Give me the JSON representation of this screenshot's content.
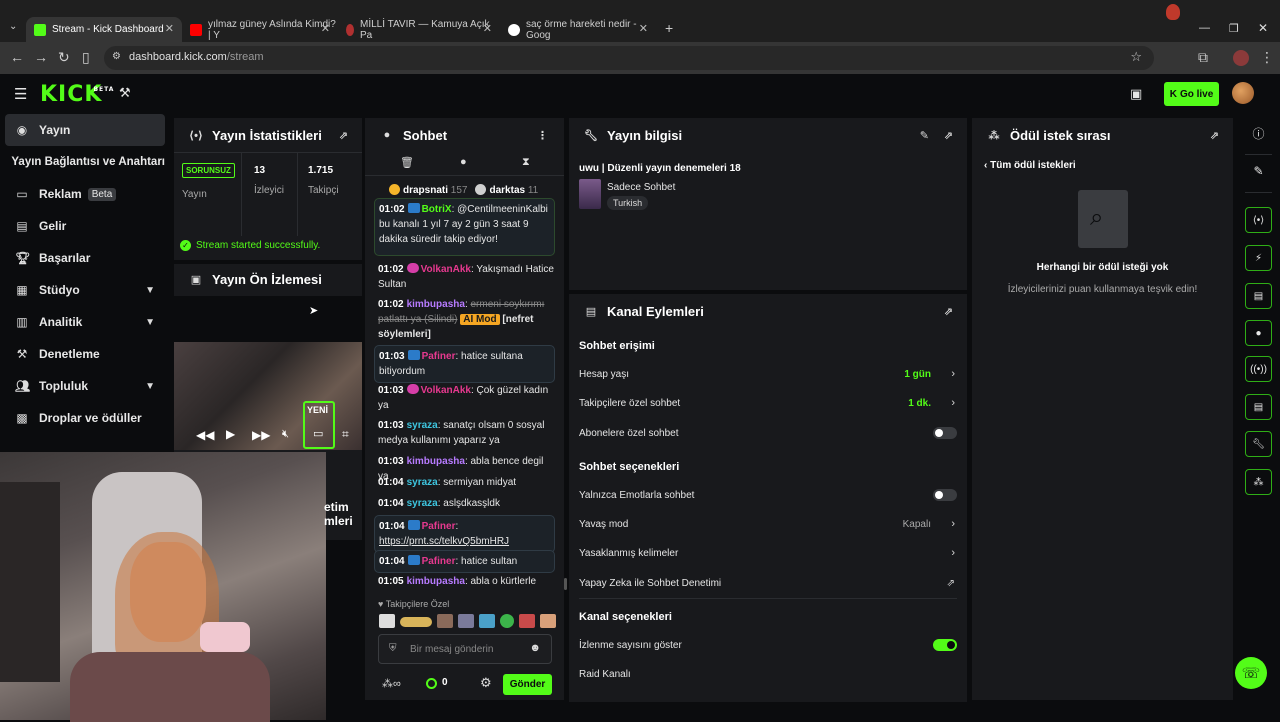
{
  "browser": {
    "tabs": [
      {
        "title": "Stream - Kick Dashboard",
        "active": true,
        "color": "#53fc18"
      },
      {
        "title": "yılmaz güney Aslında Kimdi? | Y",
        "active": false,
        "color": "#ff0000"
      },
      {
        "title": "MİLLİ TAVIR — Kamuya Açık Pa",
        "active": false,
        "color": "#b03030"
      },
      {
        "title": "saç örme hareketi nedir - Goog",
        "active": false,
        "color": "#4285f4"
      }
    ],
    "url_host": "dashboard.kick.com",
    "url_path": "/stream"
  },
  "header": {
    "logo": "KICK",
    "logo_beta": "BETA",
    "go_live": "Go live"
  },
  "sidebar": {
    "items": [
      {
        "label": "Yayın",
        "icon": "broadcast-icon"
      },
      {
        "label": "Yayın Bağlantısı ve Anahtarı",
        "icon": ""
      },
      {
        "label": "Reklam",
        "icon": "ad-icon",
        "badge": "Beta"
      },
      {
        "label": "Gelir",
        "icon": "revenue-icon"
      },
      {
        "label": "Başarılar",
        "icon": "trophy-icon"
      },
      {
        "label": "Stüdyo",
        "icon": "studio-icon"
      },
      {
        "label": "Analitik",
        "icon": "analytics-icon"
      },
      {
        "label": "Denetleme",
        "icon": "hammer-icon"
      },
      {
        "label": "Topluluk",
        "icon": "community-icon"
      },
      {
        "label": "Droplar ve ödüller",
        "icon": "drops-icon"
      }
    ]
  },
  "stats": {
    "title": "Yayın İstatistikleri",
    "status": "SORUNSUZ",
    "status_label": "Yayın",
    "viewers": "13",
    "viewers_label": "İzleyici",
    "followers": "1.715",
    "followers_label": "Takipçi",
    "success_msg": "Stream started successfully."
  },
  "preview": {
    "title": "Yayın Ön İzlemesi",
    "new_badge": "YENİ",
    "cut_text_1": "etim",
    "cut_text_2": "mleri"
  },
  "chat": {
    "title": "Sohbet",
    "top_users": [
      {
        "name": "drapsnati",
        "count": "157"
      },
      {
        "name": "darktas",
        "count": "11"
      }
    ],
    "messages": [
      {
        "time": "01:02",
        "user": "BotriX",
        "text": "@CentilmeeninKalbi bu kanalı 1 yıl 7 ay 2 gün 3 saat 9 dakika süredir takip ediyor!"
      },
      {
        "time": "01:02",
        "user": "VolkanAkk",
        "text": ": Yakışmadı Hatice Sultan"
      },
      {
        "time": "01:02",
        "user": "kimbupasha",
        "text": "ermeni soykırımı patlattı ya (Silindi)",
        "mod": "AI Mod",
        "extra": "[nefret söylemleri]"
      },
      {
        "time": "01:03",
        "user": "Pafiner",
        "text": ": hatice sultana bitiyordum"
      },
      {
        "time": "01:03",
        "user": "VolkanAkk",
        "text": ": Çok güzel kadın ya"
      },
      {
        "time": "01:03",
        "user": "syraza",
        "text": ": sanatçı olsam 0 sosyal medya kullanımı yaparız ya"
      },
      {
        "time": "01:03",
        "user": "kimbupasha",
        "text": ": abla bence degil ya"
      },
      {
        "time": "01:04",
        "user": "syraza",
        "text": ": sermiyan midyat"
      },
      {
        "time": "01:04",
        "user": "syraza",
        "text": ": aslşdkasşldk"
      },
      {
        "time": "01:04",
        "user": "Pafiner",
        "text": ":",
        "link": "https://prnt.sc/telkvQ5bmHRJ"
      },
      {
        "time": "01:04",
        "user": "Pafiner",
        "text": ": hatice sultan"
      },
      {
        "time": "01:05",
        "user": "kimbupasha",
        "text": ": abla o kürtlerle"
      }
    ],
    "emote_section": "Takipçilere Özel",
    "input_placeholder": "Bir mesaj gönderin",
    "points": "0",
    "send": "Gönder"
  },
  "stream_info": {
    "title": "Yayın bilgisi",
    "stream_title": "uwu | Düzenli yayın denemeleri 18",
    "category": "Sadece Sohbet",
    "tag": "Turkish"
  },
  "channel_actions": {
    "title": "Kanal Eylemleri",
    "chat_access": "Sohbet erişimi",
    "account_age": "Hesap yaşı",
    "account_age_val": "1 gün",
    "followers_chat": "Takipçilere özel sohbet",
    "followers_chat_val": "1 dk.",
    "subs_chat": "Abonelere özel sohbet",
    "chat_options": "Sohbet seçenekleri",
    "emote_only": "Yalnızca Emotlarla sohbet",
    "slow_mode": "Yavaş mod",
    "slow_mode_val": "Kapalı",
    "banned_words": "Yasaklanmış kelimeler",
    "ai_moderation": "Yapay Zeka ile Sohbet Denetimi",
    "channel_options": "Kanal seçenekleri",
    "show_views": "İzlenme sayısını göster",
    "raid": "Raid Kanalı"
  },
  "rewards": {
    "title": "Ödül istek sırası",
    "back": "Tüm ödül istekleri",
    "empty_title": "Herhangi bir ödül isteği yok",
    "empty_sub": "İzleyicilerinizi puan kullanmaya teşvik edin!"
  },
  "colors": {
    "accent": "#53fc18",
    "panel": "#18191c",
    "bg": "#0b0c0e"
  }
}
